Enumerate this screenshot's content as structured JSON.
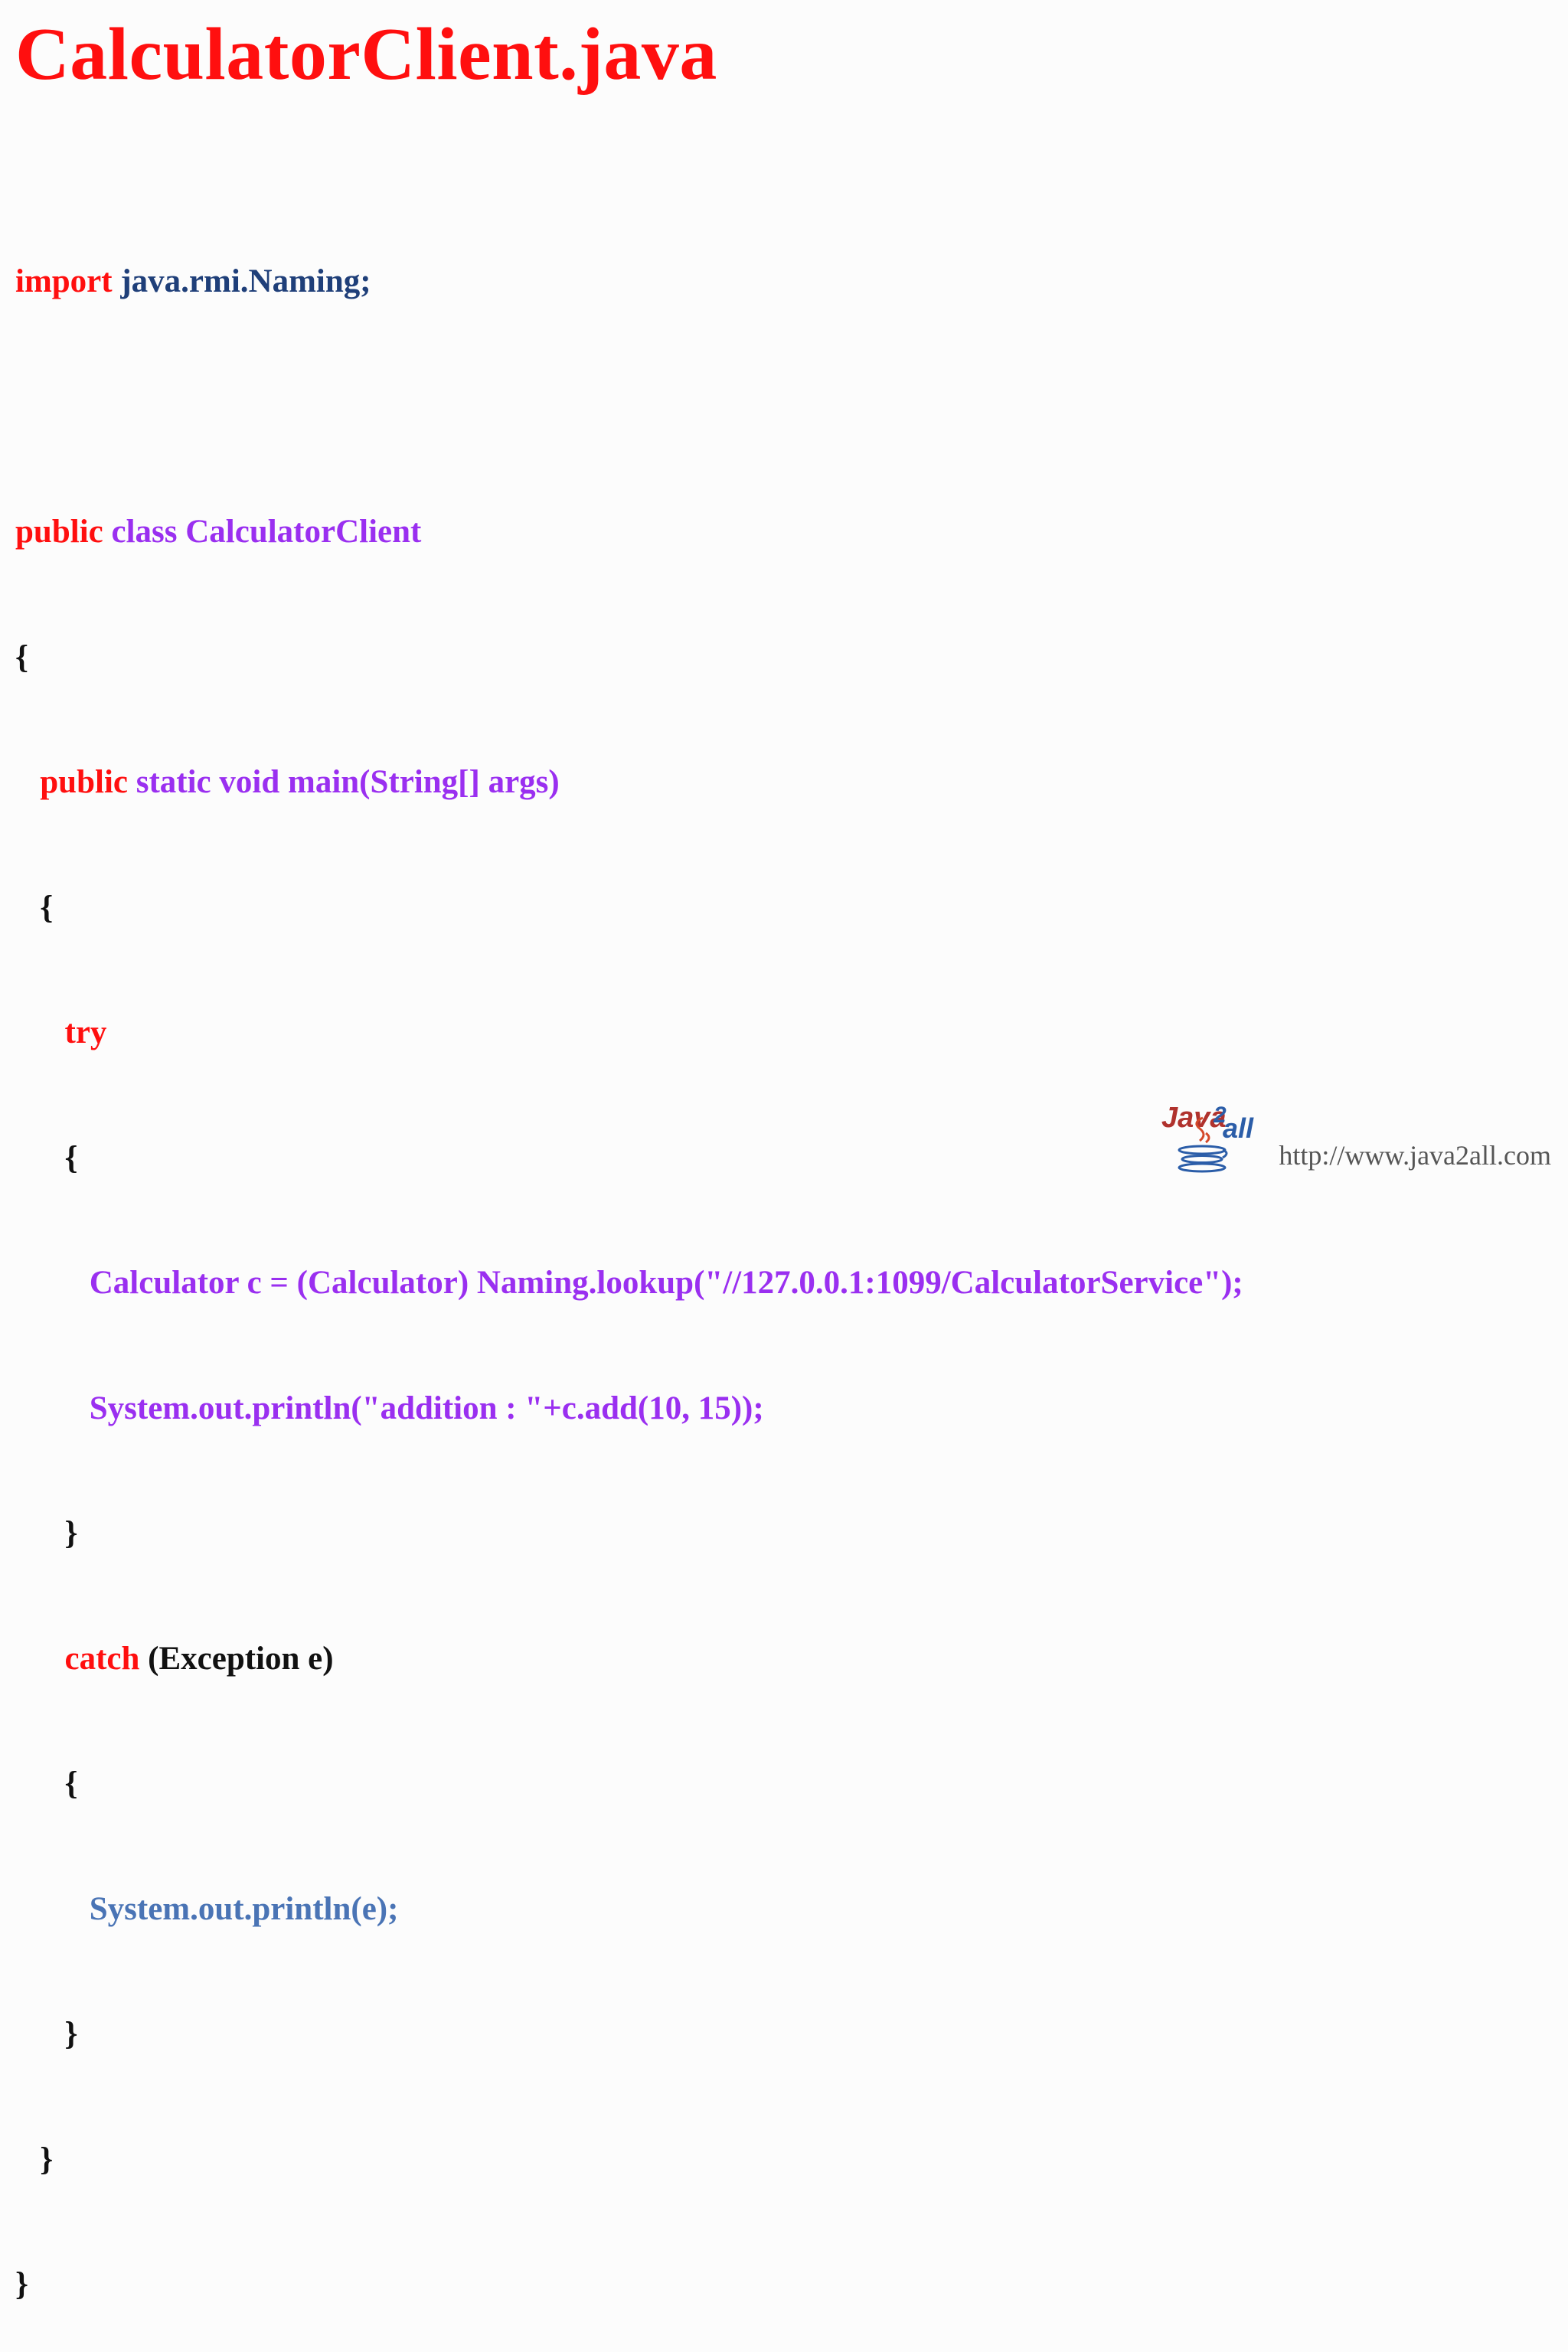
{
  "title": "CalculatorClient.java",
  "code": {
    "import_kw": "import",
    "import_pkg": "java.rmi.Naming;",
    "class_public": "public",
    "class_decl": "class CalculatorClient",
    "brace_open": "{",
    "brace_close": "}",
    "main_public": "public",
    "main_decl": "static void main(String[] args)",
    "try_kw": "try",
    "lookup_stmt": "Calculator c = (Calculator) Naming.lookup(\"//127.0.0.1:1099/CalculatorService\");",
    "print_add_stmt": "System.out.println(\"addition : \"+c.add(10, 15));",
    "catch_kw": "catch",
    "catch_param": "(Exception e)",
    "print_e_stmt": "System.out.println(e);"
  },
  "footer": {
    "logo_text": "Java2all",
    "url": "http://www.java2all.com"
  },
  "colors": {
    "keyword": "#ff0f0f",
    "package": "#1f3f79",
    "identifier": "#9a2ff0",
    "plain": "#111111",
    "catch_body": "#4a74b5"
  }
}
